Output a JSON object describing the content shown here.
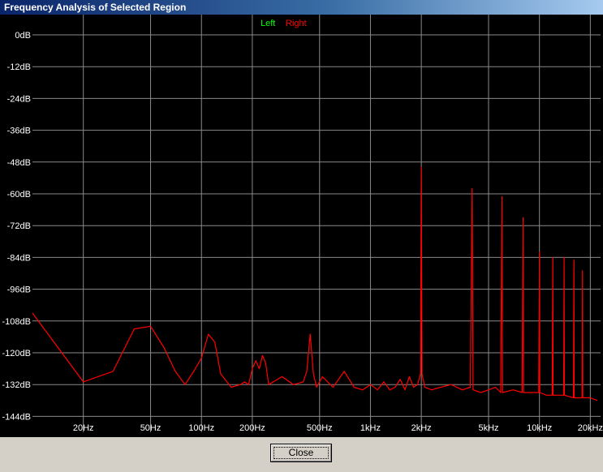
{
  "window": {
    "title": "Frequency Analysis of Selected Region"
  },
  "footer": {
    "close_label": "Close"
  },
  "chart_data": {
    "type": "line",
    "xscale": "log",
    "xlim": [
      10,
      23000
    ],
    "ylim": [
      -150,
      0
    ],
    "x_ticks": [
      {
        "value": 20,
        "label": "20Hz"
      },
      {
        "value": 50,
        "label": "50Hz"
      },
      {
        "value": 100,
        "label": "100Hz"
      },
      {
        "value": 200,
        "label": "200Hz"
      },
      {
        "value": 500,
        "label": "500Hz"
      },
      {
        "value": 1000,
        "label": "1kHz"
      },
      {
        "value": 2000,
        "label": "2kHz"
      },
      {
        "value": 5000,
        "label": "5kHz"
      },
      {
        "value": 10000,
        "label": "10kHz"
      },
      {
        "value": 20000,
        "label": "20kHz"
      }
    ],
    "y_ticks": [
      {
        "value": 0,
        "label": "0dB"
      },
      {
        "value": -12,
        "label": "-12dB"
      },
      {
        "value": -24,
        "label": "-24dB"
      },
      {
        "value": -36,
        "label": "-36dB"
      },
      {
        "value": -48,
        "label": "-48dB"
      },
      {
        "value": -60,
        "label": "-60dB"
      },
      {
        "value": -72,
        "label": "-72dB"
      },
      {
        "value": -84,
        "label": "-84dB"
      },
      {
        "value": -96,
        "label": "-96dB"
      },
      {
        "value": -108,
        "label": "-108dB"
      },
      {
        "value": -120,
        "label": "-120dB"
      },
      {
        "value": -132,
        "label": "-132dB"
      },
      {
        "value": -144,
        "label": "-144dB"
      }
    ],
    "grid": true,
    "legend_position": "top-center",
    "series": [
      {
        "name": "Left",
        "color": "#00ff00",
        "points": []
      },
      {
        "name": "Right",
        "color": "#ff0000",
        "points": [
          [
            10,
            -105
          ],
          [
            20,
            -131
          ],
          [
            30,
            -127
          ],
          [
            40,
            -111
          ],
          [
            50,
            -110
          ],
          [
            60,
            -118
          ],
          [
            70,
            -127
          ],
          [
            80,
            -132
          ],
          [
            90,
            -127
          ],
          [
            100,
            -122
          ],
          [
            110,
            -113
          ],
          [
            120,
            -116
          ],
          [
            130,
            -128
          ],
          [
            150,
            -133
          ],
          [
            170,
            -132
          ],
          [
            180,
            -131
          ],
          [
            190,
            -132
          ],
          [
            200,
            -126
          ],
          [
            210,
            -123
          ],
          [
            220,
            -126
          ],
          [
            230,
            -121
          ],
          [
            240,
            -124
          ],
          [
            250,
            -132
          ],
          [
            300,
            -129
          ],
          [
            350,
            -132
          ],
          [
            400,
            -131
          ],
          [
            420,
            -127
          ],
          [
            440,
            -113
          ],
          [
            460,
            -128
          ],
          [
            480,
            -133
          ],
          [
            520,
            -129
          ],
          [
            600,
            -133
          ],
          [
            700,
            -127
          ],
          [
            800,
            -133
          ],
          [
            900,
            -134
          ],
          [
            1000,
            -132
          ],
          [
            1100,
            -134
          ],
          [
            1200,
            -131
          ],
          [
            1300,
            -134
          ],
          [
            1400,
            -133
          ],
          [
            1500,
            -130
          ],
          [
            1600,
            -134
          ],
          [
            1700,
            -129
          ],
          [
            1800,
            -133
          ],
          [
            1900,
            -132
          ],
          [
            1980,
            -128
          ],
          [
            2000,
            -50
          ],
          [
            2020,
            -128
          ],
          [
            2100,
            -133
          ],
          [
            2300,
            -134
          ],
          [
            2600,
            -133
          ],
          [
            3000,
            -132
          ],
          [
            3500,
            -134
          ],
          [
            3900,
            -133
          ],
          [
            4000,
            -58
          ],
          [
            4050,
            -134
          ],
          [
            4500,
            -135
          ],
          [
            5000,
            -134
          ],
          [
            5500,
            -133
          ],
          [
            5900,
            -135
          ],
          [
            6000,
            -61
          ],
          [
            6050,
            -135
          ],
          [
            7000,
            -134
          ],
          [
            7900,
            -135
          ],
          [
            8000,
            -69
          ],
          [
            8050,
            -135
          ],
          [
            9000,
            -135
          ],
          [
            9900,
            -135
          ],
          [
            10000,
            -82
          ],
          [
            10050,
            -135
          ],
          [
            11000,
            -136
          ],
          [
            11900,
            -136
          ],
          [
            12000,
            -84
          ],
          [
            12050,
            -136
          ],
          [
            13900,
            -136
          ],
          [
            14000,
            -84
          ],
          [
            14050,
            -136
          ],
          [
            15900,
            -137
          ],
          [
            16000,
            -85
          ],
          [
            16050,
            -137
          ],
          [
            17900,
            -137
          ],
          [
            18000,
            -89
          ],
          [
            18050,
            -137
          ],
          [
            20000,
            -137
          ],
          [
            22000,
            -138
          ]
        ]
      }
    ]
  }
}
